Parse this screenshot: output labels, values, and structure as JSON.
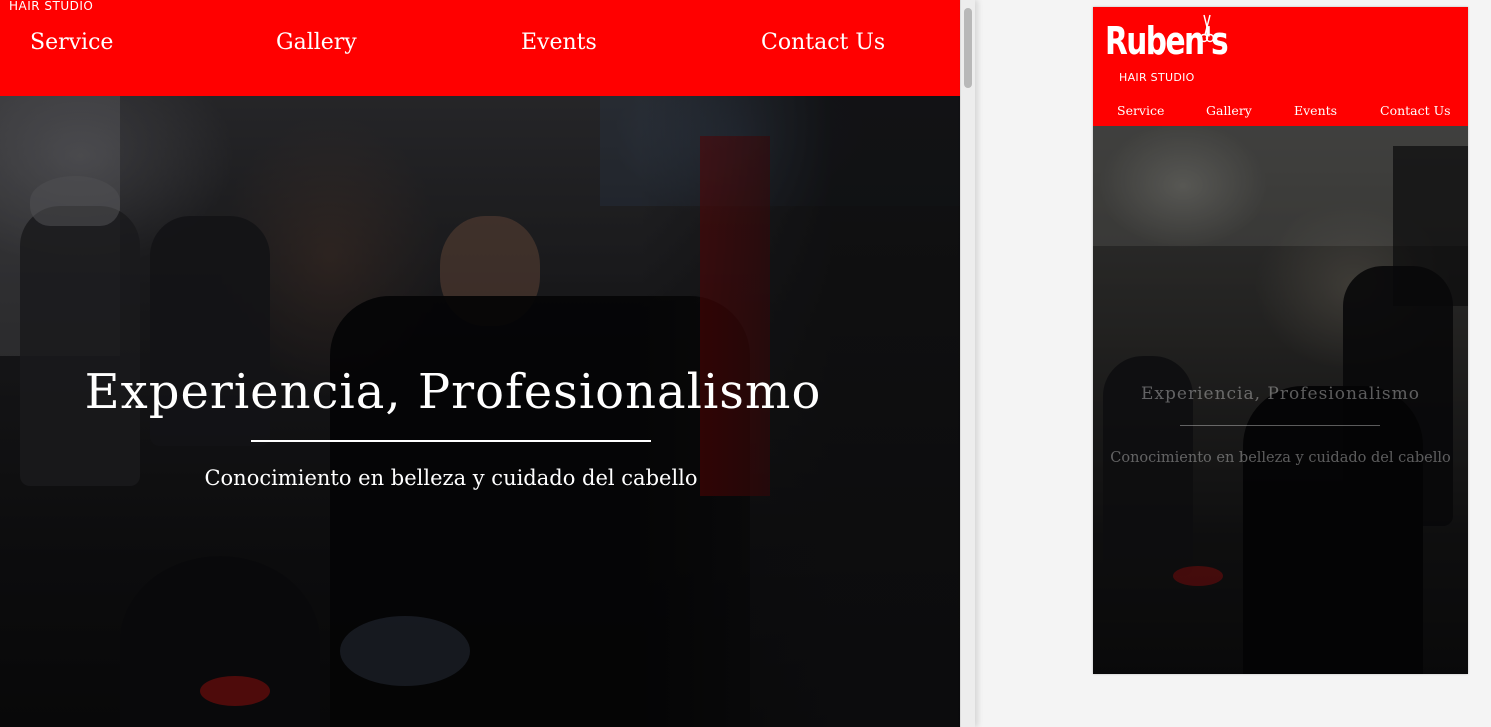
{
  "brand": {
    "logo_text": "Ruben's",
    "tagline": "HAIR STUDIO"
  },
  "nav": {
    "items": [
      {
        "label": "Service"
      },
      {
        "label": "Gallery"
      },
      {
        "label": "Events"
      },
      {
        "label": "Contact Us"
      }
    ]
  },
  "hero": {
    "title": "Experiencia, Profesionalismo",
    "subtitle": "Conocimiento en belleza y cuidado del cabello",
    "image_description_icon": "barbershop-photo"
  },
  "colors": {
    "brand_red": "#ff0000",
    "text_white": "#ffffff"
  },
  "icons": {
    "logo_icon": "scissors-icon"
  }
}
